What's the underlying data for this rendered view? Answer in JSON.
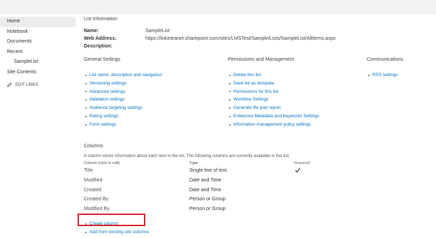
{
  "nav": {
    "items": [
      {
        "label": "Home"
      },
      {
        "label": "Notebook"
      },
      {
        "label": "Documents"
      },
      {
        "label": "Recent"
      },
      {
        "label": "SampleList"
      },
      {
        "label": "Site Contents"
      }
    ],
    "edit_links": "EDIT LINKS"
  },
  "list_info": {
    "title": "List Information",
    "name_label": "Name:",
    "name_value": "SampleList",
    "web_label": "Web Address:",
    "web_value": "https://linkintranet.sharepoint.com/sites/LMSTest/Sample/Lists/SampleList/AllItems.aspx",
    "desc_label": "Description:",
    "desc_value": ""
  },
  "general": {
    "heading": "General Settings",
    "links": [
      "List name, description and navigation",
      "Versioning settings",
      "Advanced settings",
      "Validation settings",
      "Audience targeting settings",
      "Rating settings",
      "Form settings"
    ]
  },
  "permissions": {
    "heading": "Permissions and Management",
    "links": [
      "Delete this list",
      "Save list as template",
      "Permissions for this list",
      "Workflow Settings",
      "Generate file plan report",
      "Enterprise Metadata and Keywords Settings",
      "Information management policy settings"
    ]
  },
  "communications": {
    "heading": "Communications",
    "links": [
      "RSS settings"
    ]
  },
  "columns": {
    "heading": "Columns",
    "description": "A column stores information about each item in the list. The following columns are currently available in this list:",
    "headers": [
      "Column (click to edit)",
      "Type",
      "Required"
    ],
    "rows": [
      {
        "name": "Title",
        "type": "Single line of text",
        "required": true
      },
      {
        "name": "Modified",
        "type": "Date and Time",
        "required": false
      },
      {
        "name": "Created",
        "type": "Date and Time",
        "required": false
      },
      {
        "name": "Created By",
        "type": "Person or Group",
        "required": false
      },
      {
        "name": "Modified By",
        "type": "Person or Group",
        "required": false
      }
    ],
    "create_column": "Create column",
    "add_existing": "Add from existing site columns"
  }
}
